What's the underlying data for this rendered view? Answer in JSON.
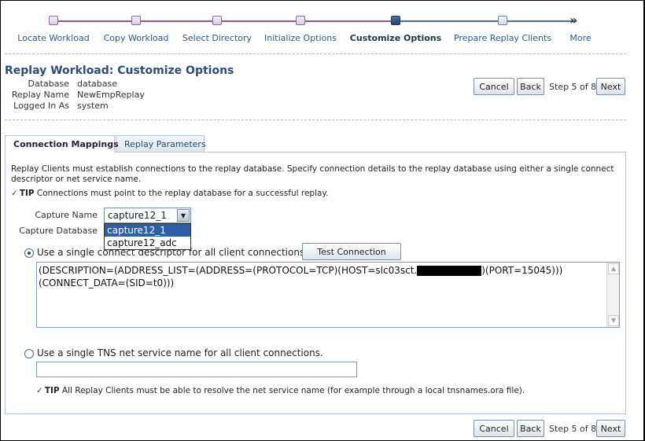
{
  "train": {
    "steps": [
      {
        "label": "Locate Workload",
        "state": "visited"
      },
      {
        "label": "Copy Workload",
        "state": "visited"
      },
      {
        "label": "Select Directory",
        "state": "visited"
      },
      {
        "label": "Initialize Options",
        "state": "visited"
      },
      {
        "label": "Customize Options",
        "state": "current"
      },
      {
        "label": "Prepare Replay Clients",
        "state": "future"
      },
      {
        "label": "More",
        "state": "future"
      }
    ],
    "more_icon": "double-chevron-right-icon"
  },
  "header": {
    "title": "Replay Workload: Customize Options",
    "database_label": "Database",
    "database_value": "database",
    "replay_name_label": "Replay Name",
    "replay_name_value": "NewEmpReplay",
    "logged_in_label": "Logged In As",
    "logged_in_value": "system"
  },
  "nav": {
    "cancel": "Cancel",
    "back": "Back",
    "step": "Step 5 of 8",
    "next": "Next"
  },
  "tabs": [
    {
      "label": "Connection Mappings",
      "active": true
    },
    {
      "label": "Replay Parameters",
      "active": false
    }
  ],
  "content": {
    "description": "Replay Clients must establish connections to the replay database. Specify connection details to the replay database using either a single connect descriptor or net service name.",
    "tip1_prefix": "TIP",
    "tip1_text": "Connections must point to the replay database for a successful replay.",
    "capture_name_label": "Capture Name",
    "capture_name_value": "capture12_1",
    "capture_options": [
      "capture12_1",
      "capture12_adc"
    ],
    "capture_database_label": "Capture Database",
    "option1_label": "Use a single connect descriptor for all client connections.",
    "test_connection": "Test Connection",
    "descriptor_part1": "(DESCRIPTION=(ADDRESS_LIST=(ADDRESS=(PROTOCOL=TCP)(HOST=slc03sct.",
    "descriptor_part2": ")(PORT=15045)))",
    "descriptor_line2": "(CONNECT_DATA=(SID=t0)))",
    "option2_label": "Use a single TNS net service name for all client connections.",
    "tip2_prefix": "TIP",
    "tip2_text": "All Replay Clients must be able to resolve the net service name (for example through a local tnsnames.ora file)."
  },
  "colors": {
    "title": "#2d4d78",
    "link": "#2a5a8a",
    "selected_option": "#2d5fa8"
  }
}
